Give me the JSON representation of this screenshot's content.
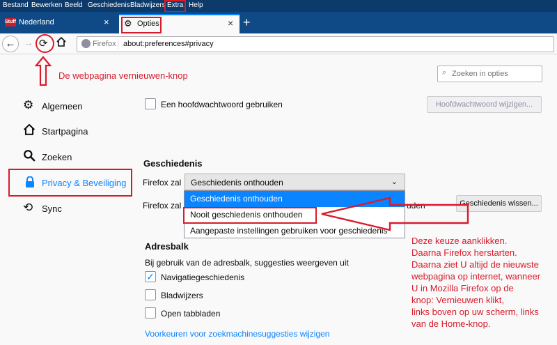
{
  "menu": {
    "items": [
      "Bestand",
      "Bewerken",
      "Beeld",
      "Geschiedenis",
      "Bladwijzers",
      "Extra",
      "Help"
    ]
  },
  "tabs": {
    "nl": {
      "icon_text": "Stuff",
      "label": "Nederland",
      "close": "×"
    },
    "opties": {
      "label": "Opties",
      "close": "×"
    },
    "new_tab": "+"
  },
  "navbar": {
    "site": "Firefox",
    "url": "about:preferences#privacy"
  },
  "annotations": {
    "reload_note": "De webpagina vernieuwen-knop",
    "right_note": [
      "Deze keuze aanklikken.",
      "Daarna Firefox herstarten.",
      "Daarna ziet U altijd de nieuwste",
      "webpagina op internet, wanneer",
      "U in Mozilla Firefox op de",
      "knop: Vernieuwen klikt,",
      "links boven op uw scherm, links",
      "van de Home-knop."
    ],
    "color": "#d81b2a"
  },
  "search": {
    "placeholder": "Zoeken in opties"
  },
  "sidebar": {
    "items": [
      {
        "label": "Algemeen",
        "icon": "gear-icon"
      },
      {
        "label": "Startpagina",
        "icon": "home-icon"
      },
      {
        "label": "Zoeken",
        "icon": "search-icon"
      },
      {
        "label": "Privacy & Beveiliging",
        "icon": "lock-icon"
      },
      {
        "label": "Sync",
        "icon": "sync-icon"
      }
    ],
    "selected": "Privacy & Beveiliging"
  },
  "main": {
    "master_password": {
      "label": "Een hoofdwachtwoord gebruiken",
      "checked": false,
      "button": "Hoofdwachtwoord wijzigen..."
    },
    "history": {
      "heading": "Geschiedenis",
      "firefox_will": "Firefox zal",
      "select_value": "Geschiedenis onthouden",
      "options": [
        "Geschiedenis onthouden",
        "Nooit geschiedenis onthouden",
        "Aangepaste instellingen gebruiken voor geschiedenis"
      ],
      "behind_text_left": "Firefox zal",
      "behind_text_right": "uden",
      "clear_button": "Geschiedenis wissen..."
    },
    "addressbar": {
      "heading": "Adresbalk",
      "description": "Bij gebruik van de adresbalk, suggesties weergeven uit",
      "options": [
        {
          "label": "Navigatiegeschiedenis",
          "checked": true
        },
        {
          "label": "Bladwijzers",
          "checked": false
        },
        {
          "label": "Open tabbladen",
          "checked": false
        }
      ],
      "link": "Voorkeuren voor zoekmachinesuggesties wijzigen"
    }
  },
  "colors": {
    "accent": "#0a84ff",
    "menubar": "#0c3a6b",
    "tabstrip": "#0f4a86"
  }
}
